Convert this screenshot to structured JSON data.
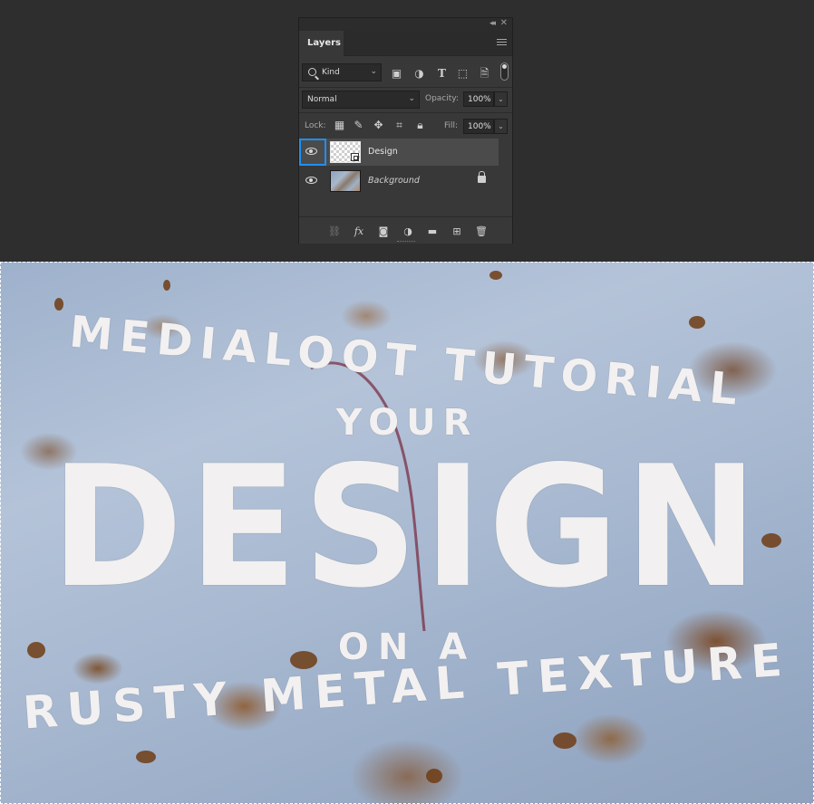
{
  "panel": {
    "tab_label": "Layers",
    "filter": {
      "kind_label": "Kind",
      "icons": [
        "image-filter-icon",
        "adjustment-filter-icon",
        "type-filter-icon",
        "shape-filter-icon",
        "smart-object-filter-icon"
      ],
      "type_glyph": "T"
    },
    "blend": {
      "mode": "Normal",
      "opacity_label": "Opacity:",
      "opacity_value": "100%"
    },
    "lock": {
      "label": "Lock:",
      "fill_label": "Fill:",
      "fill_value": "100%"
    },
    "layers": [
      {
        "name": "Design",
        "visible": true,
        "selected": true,
        "type": "smart-object"
      },
      {
        "name": "Background",
        "visible": true,
        "selected": false,
        "locked": true,
        "type": "image"
      }
    ],
    "bottom": {
      "fx_label": "fx"
    }
  },
  "canvas": {
    "lines": [
      "MEDIALOOT TUTORIAL",
      "YOUR",
      "DESIGN",
      "ON A",
      "RUSTY METAL TEXTURE"
    ],
    "accent_text_color": "#f2f0f0",
    "selection_border_color": "#ffffff"
  },
  "colors": {
    "panel_bg": "#383838",
    "app_bg": "#2e2e2e",
    "selection_accent": "#1f8ff3"
  }
}
